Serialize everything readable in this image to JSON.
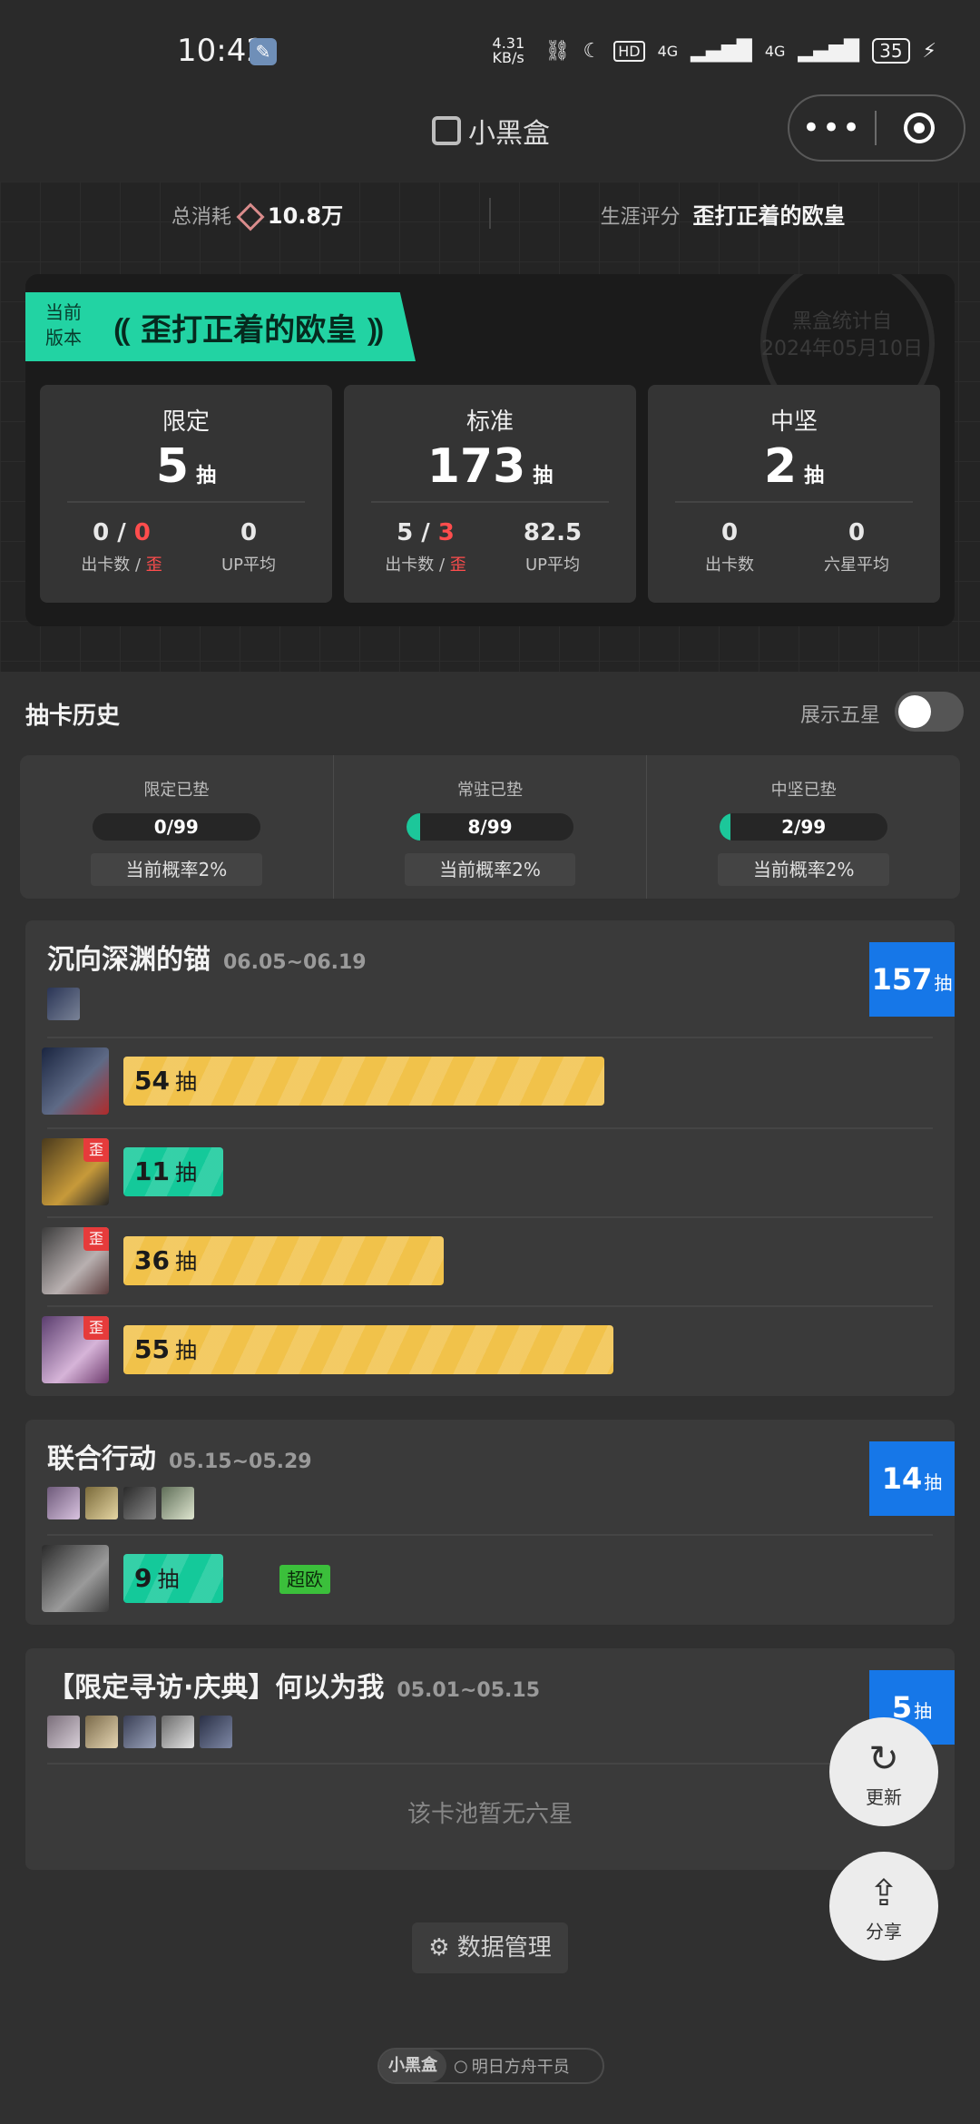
{
  "status": {
    "time": "10:42",
    "netspeed": "4.31 KB/s",
    "hd": "HD",
    "signal1": "4G",
    "signal2": "4G",
    "battery": "35"
  },
  "nav": {
    "title": "小黑盒",
    "more_icon": "•••"
  },
  "summary": {
    "consume_label": "总消耗",
    "consume_value": "10.8万",
    "rating_label": "生涯评分",
    "rating_value": "歪打正着的欧皇"
  },
  "version": {
    "tag_line1": "当前",
    "tag_line2": "版本",
    "title": "歪打正着的欧皇",
    "stamp_line1": "黑盒统计自",
    "stamp_line2": "2024年05月10日",
    "boxes": [
      {
        "title": "限定",
        "count": "5",
        "unit": "抽",
        "a_num": "0",
        "a_slash": " / ",
        "a_red": "0",
        "a_label": "出卡数 / ",
        "a_label_red": "歪",
        "b_num": "0",
        "b_label": "UP平均"
      },
      {
        "title": "标准",
        "count": "173",
        "unit": "抽",
        "a_num": "5",
        "a_slash": " / ",
        "a_red": "3",
        "a_label": "出卡数 / ",
        "a_label_red": "歪",
        "b_num": "82.5",
        "b_label": "UP平均"
      },
      {
        "title": "中坚",
        "count": "2",
        "unit": "抽",
        "a_num": "0",
        "a_slash": "",
        "a_red": "",
        "a_label": "出卡数",
        "a_label_red": "",
        "b_num": "0",
        "b_label": "六星平均"
      }
    ]
  },
  "history": {
    "title": "抽卡历史",
    "show_five_label": "展示五星",
    "show_five_on": false,
    "pity": [
      {
        "label": "限定已垫",
        "count": "0/99",
        "fraction": 0,
        "prob": "当前概率2%"
      },
      {
        "label": "常驻已垫",
        "count": "8/99",
        "fraction": 0.081,
        "prob": "当前概率2%"
      },
      {
        "label": "中坚已垫",
        "count": "2/99",
        "fraction": 0.02,
        "prob": "当前概率2%"
      }
    ],
    "pools": [
      {
        "name": "沉向深渊的锚",
        "date": "06.05~06.19",
        "total": "157",
        "unit": "抽",
        "rows": [
          {
            "pulls": "54",
            "unit": "抽",
            "off": false,
            "color": "gold"
          },
          {
            "pulls": "11",
            "unit": "抽",
            "off": true,
            "off_label": "歪",
            "color": "green"
          },
          {
            "pulls": "36",
            "unit": "抽",
            "off": true,
            "off_label": "歪",
            "color": "gold"
          },
          {
            "pulls": "55",
            "unit": "抽",
            "off": true,
            "off_label": "歪",
            "color": "gold"
          }
        ]
      },
      {
        "name": "联合行动",
        "date": "05.15~05.29",
        "total": "14",
        "unit": "抽",
        "rows": [
          {
            "pulls": "9",
            "unit": "抽",
            "off": false,
            "color": "green",
            "tag": "超欧"
          }
        ]
      },
      {
        "name": "【限定寻访·庆典】何以为我",
        "date": "05.01~05.15",
        "total": "5",
        "unit": "抽",
        "empty": "该卡池暂无六星"
      }
    ]
  },
  "fabs": {
    "refresh": "更新",
    "share": "分享"
  },
  "data_manage": "数据管理",
  "footer": {
    "brand": "小黑盒",
    "app": "明日方舟干员"
  },
  "colors": {
    "accent_green": "#14c99a",
    "gold": "#f1c24a",
    "badge_blue": "#1677e8",
    "red": "#e63b3b"
  }
}
